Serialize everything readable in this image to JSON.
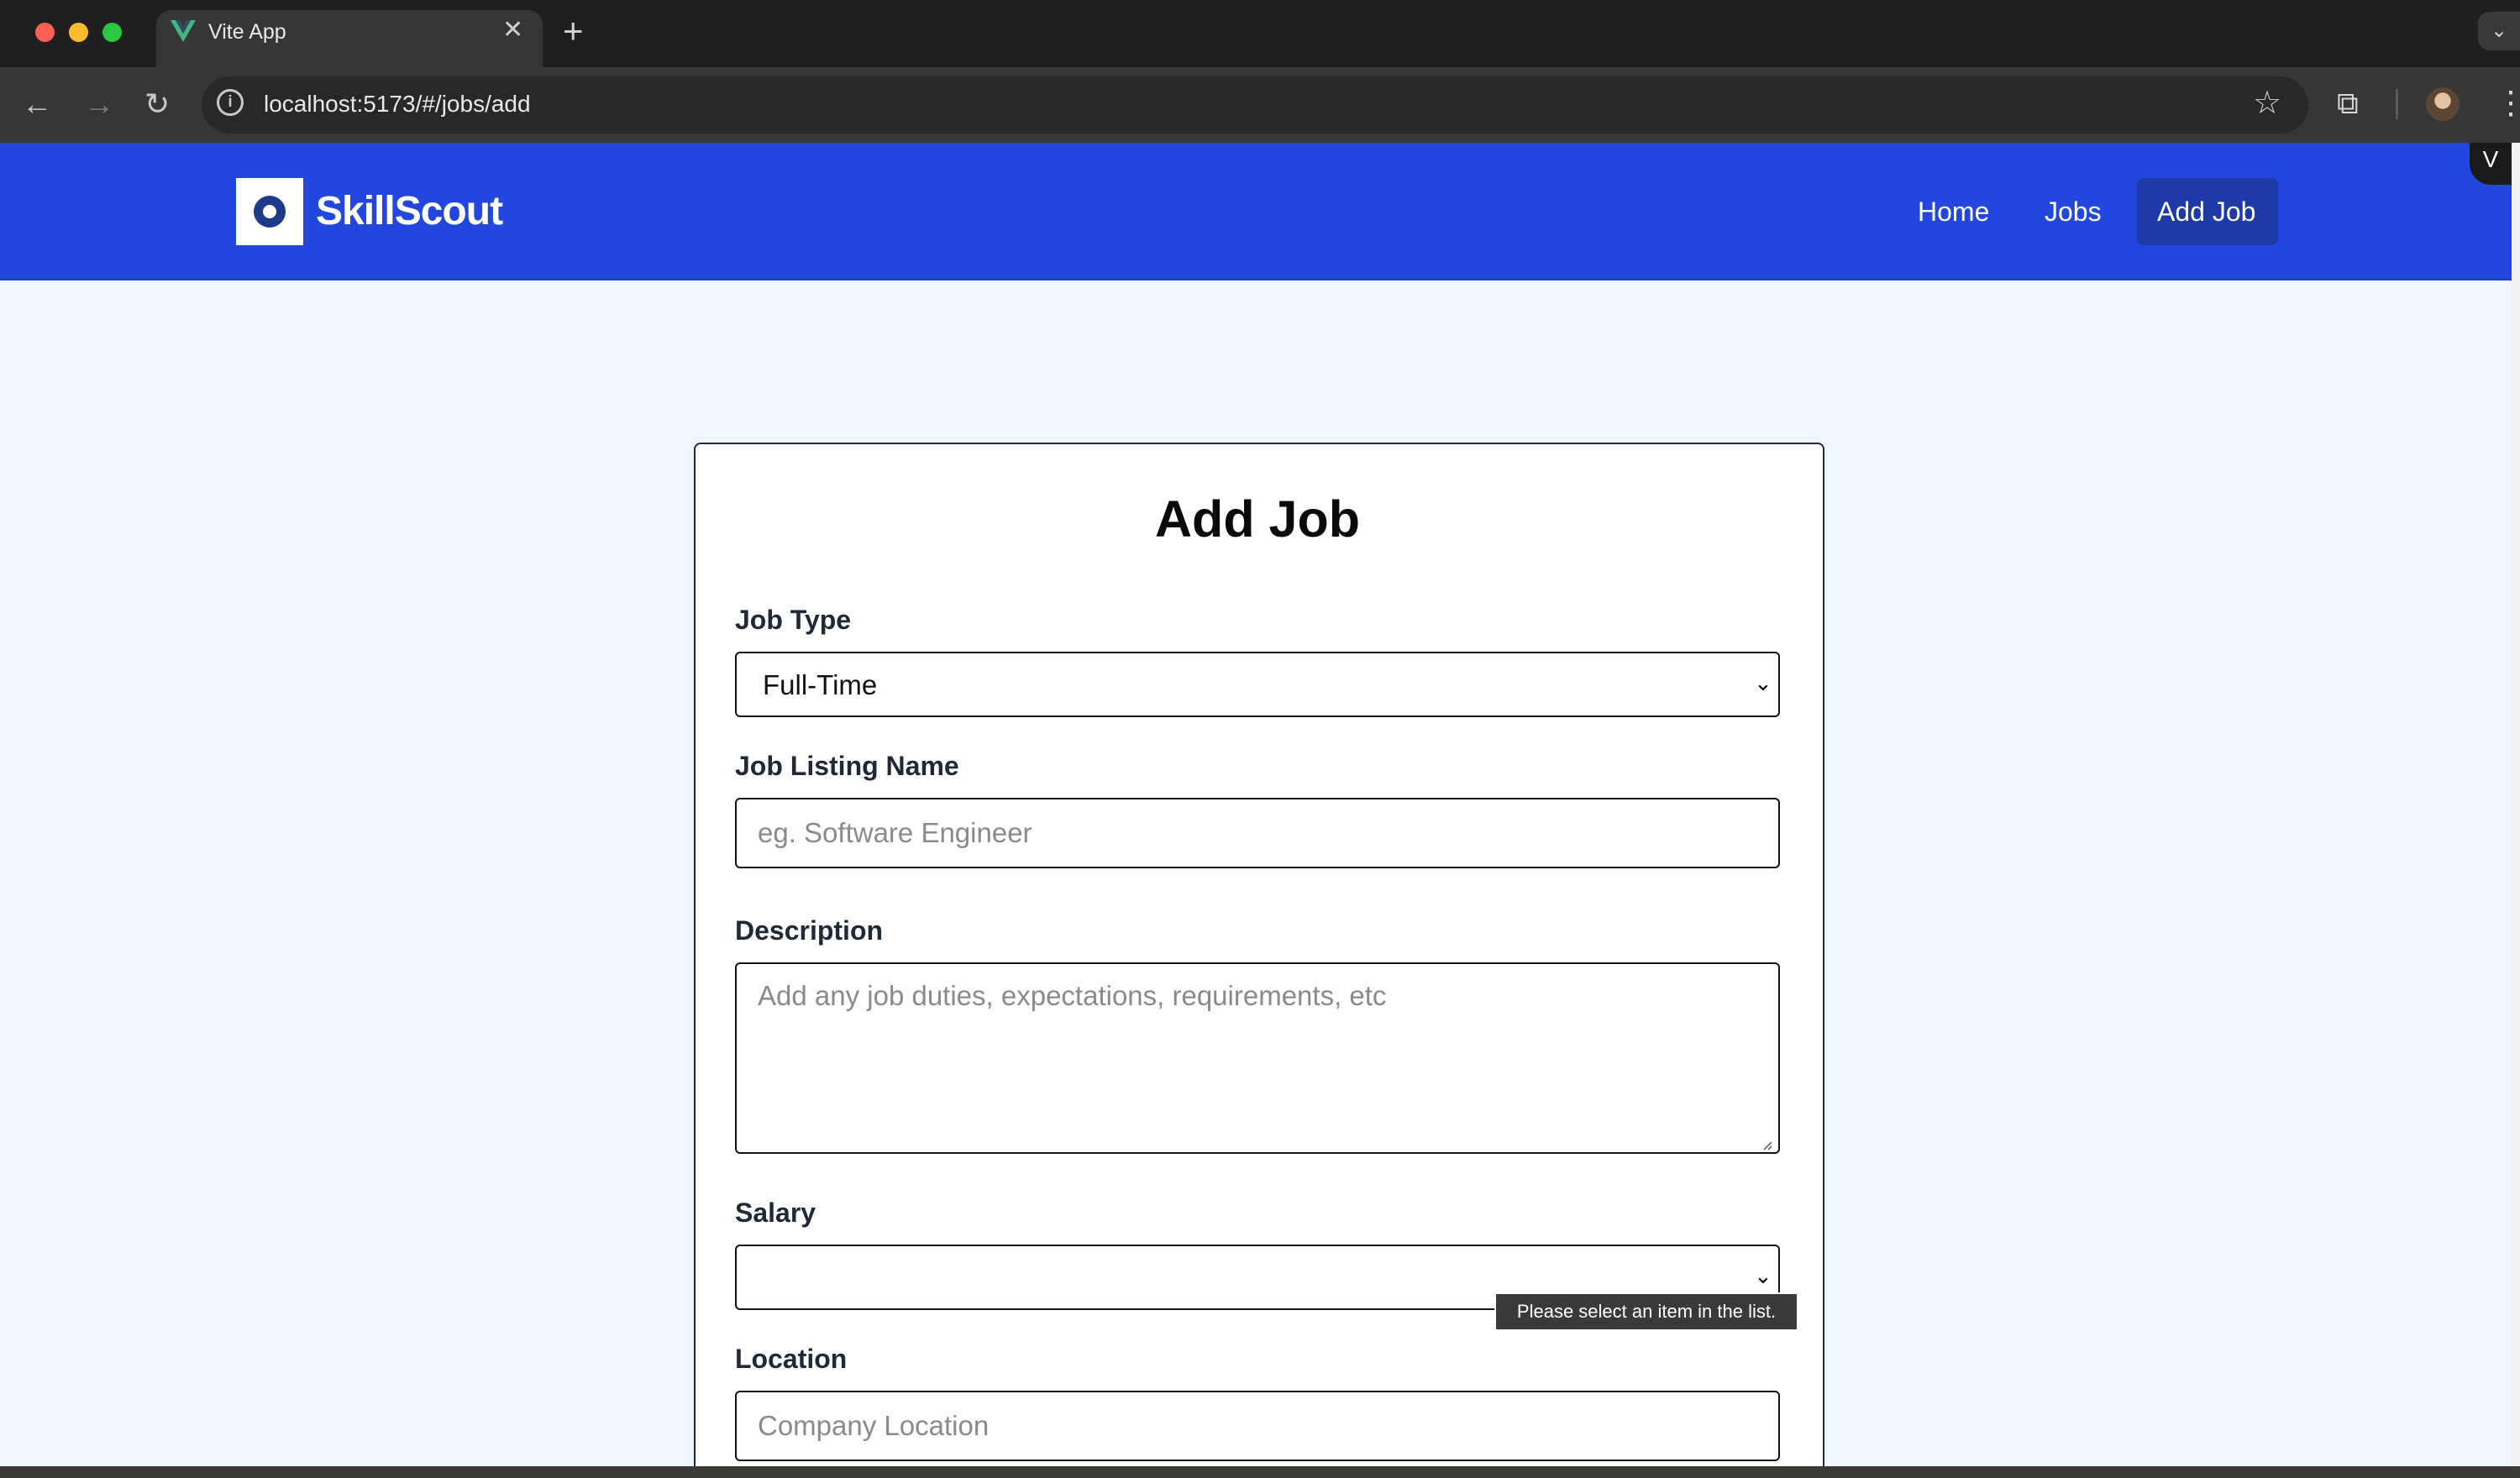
{
  "browser": {
    "tab_title": "Vite App",
    "url": "localhost:5173/#/jobs/add",
    "colors": {
      "close": "#ff5f57",
      "minimize": "#febc2e",
      "maximize": "#28c840"
    }
  },
  "header": {
    "brand": "SkillScout",
    "nav": [
      "Home",
      "Jobs",
      "Add Job"
    ],
    "active_nav": "Add Job",
    "badge": "V",
    "accent": "#2347de"
  },
  "form": {
    "title": "Add Job",
    "job_type": {
      "label": "Job Type",
      "value": "Full-Time"
    },
    "listing_name": {
      "label": "Job Listing Name",
      "placeholder": "eg. Software Engineer"
    },
    "description": {
      "label": "Description",
      "placeholder": "Add any job duties, expectations, requirements, etc"
    },
    "salary": {
      "label": "Salary",
      "value": ""
    },
    "location": {
      "label": "Location",
      "placeholder": "Company Location"
    },
    "validation_tooltip": "Please select an item in the list."
  }
}
